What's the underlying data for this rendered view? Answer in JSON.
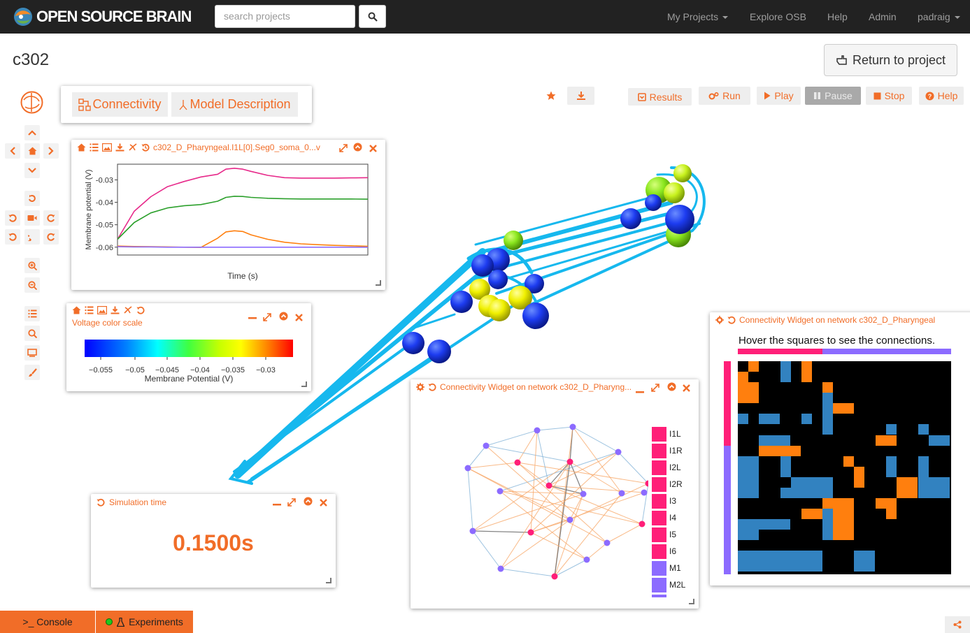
{
  "nav": {
    "brand": "OPEN SOURCE BRAIN",
    "search_placeholder": "search projects",
    "links": [
      "My Projects",
      "Explore OSB",
      "Help",
      "Admin",
      "padraig"
    ]
  },
  "page": {
    "title": "c302",
    "return_label": "Return to project"
  },
  "toolbar": {
    "results": "Results",
    "run": "Run",
    "play": "Play",
    "pause": "Pause",
    "stop": "Stop",
    "help": "Help"
  },
  "tabs": {
    "connectivity": "Connectivity",
    "model_description": "Model Description"
  },
  "plot_widget": {
    "title": "c302_D_Pharyngeal.I1L[0].Seg0_soma_0...v",
    "ylabel": "Membrane potential (V)",
    "xlabel": "Time (s)",
    "yticks": [
      "-0.03",
      "-0.04",
      "-0.05",
      "-0.06"
    ]
  },
  "chart_data": {
    "type": "line",
    "title": "c302_D_Pharyngeal.I1L[0].Seg0_soma_0...v",
    "xlabel": "Time (s)",
    "ylabel": "Membrane potential (V)",
    "xlim": [
      0,
      0.15
    ],
    "ylim": [
      -0.0635,
      -0.023
    ],
    "yticks": [
      -0.03,
      -0.04,
      -0.05,
      -0.06
    ],
    "x": [
      0,
      0.01,
      0.02,
      0.03,
      0.04,
      0.05,
      0.06,
      0.065,
      0.07,
      0.075,
      0.08,
      0.09,
      0.1,
      0.11,
      0.12,
      0.13,
      0.14,
      0.15
    ],
    "series": [
      {
        "color": "#e7298a",
        "values": [
          -0.0565,
          -0.044,
          -0.0375,
          -0.033,
          -0.0307,
          -0.0287,
          -0.0275,
          -0.0252,
          -0.0248,
          -0.0252,
          -0.0262,
          -0.028,
          -0.029,
          -0.0292,
          -0.0292,
          -0.0292,
          -0.0291,
          -0.029
        ]
      },
      {
        "color": "#2ca02c",
        "values": [
          -0.0565,
          -0.049,
          -0.0447,
          -0.0425,
          -0.0415,
          -0.041,
          -0.0395,
          -0.0378,
          -0.0373,
          -0.0374,
          -0.0378,
          -0.0382,
          -0.0384,
          -0.0385,
          -0.0385,
          -0.0385,
          -0.0385,
          -0.0386
        ]
      },
      {
        "color": "#ff7f0e",
        "values": [
          -0.0595,
          -0.0597,
          -0.0598,
          -0.0599,
          -0.06,
          -0.0601,
          -0.056,
          -0.0532,
          -0.0527,
          -0.053,
          -0.0545,
          -0.0565,
          -0.0578,
          -0.0585,
          -0.0589,
          -0.0592,
          -0.0594,
          -0.0596
        ]
      },
      {
        "color": "#8c6bff",
        "values": [
          -0.0598,
          -0.0599,
          -0.0599,
          -0.06,
          -0.06,
          -0.06,
          -0.06,
          -0.06,
          -0.06,
          -0.06,
          -0.06,
          -0.06,
          -0.06,
          -0.06,
          -0.06,
          -0.06,
          -0.06,
          -0.06
        ]
      }
    ]
  },
  "color_scale": {
    "title": "Voltage color scale",
    "ticks": [
      "−0.055",
      "−0.05",
      "−0.045",
      "−0.04",
      "−0.035",
      "−0.03"
    ],
    "label": "Membrane Potential (V)"
  },
  "sim_time": {
    "title": "Simulation time",
    "value": "0.1500s"
  },
  "conn_widget": {
    "title": "Connectivity Widget on network c302_D_Pharyng...",
    "legend": [
      {
        "label": "I1L",
        "color": "#ff1f78"
      },
      {
        "label": "I1R",
        "color": "#ff1f78"
      },
      {
        "label": "I2L",
        "color": "#ff1f78"
      },
      {
        "label": "I2R",
        "color": "#ff1f78"
      },
      {
        "label": "I3",
        "color": "#ff1f78"
      },
      {
        "label": "I4",
        "color": "#ff1f78"
      },
      {
        "label": "I5",
        "color": "#ff1f78"
      },
      {
        "label": "I6",
        "color": "#ff1f78"
      },
      {
        "label": "M1",
        "color": "#8c6bff"
      },
      {
        "label": "M2L",
        "color": "#8c6bff"
      }
    ]
  },
  "matrix_widget": {
    "title": "Connectivity Widget on network c302_D_Pharyngeal",
    "hint": "Hover the squares to see the connections."
  },
  "bottom": {
    "console": ">_ Console",
    "experiments": "Experiments"
  },
  "colors": {
    "accent": "#f16d28",
    "navbar": "#222222",
    "excitatory": "#ff7f0e",
    "inhibitory": "#3282c0",
    "interneuron": "#ff1f78",
    "motor": "#8c6bff"
  }
}
